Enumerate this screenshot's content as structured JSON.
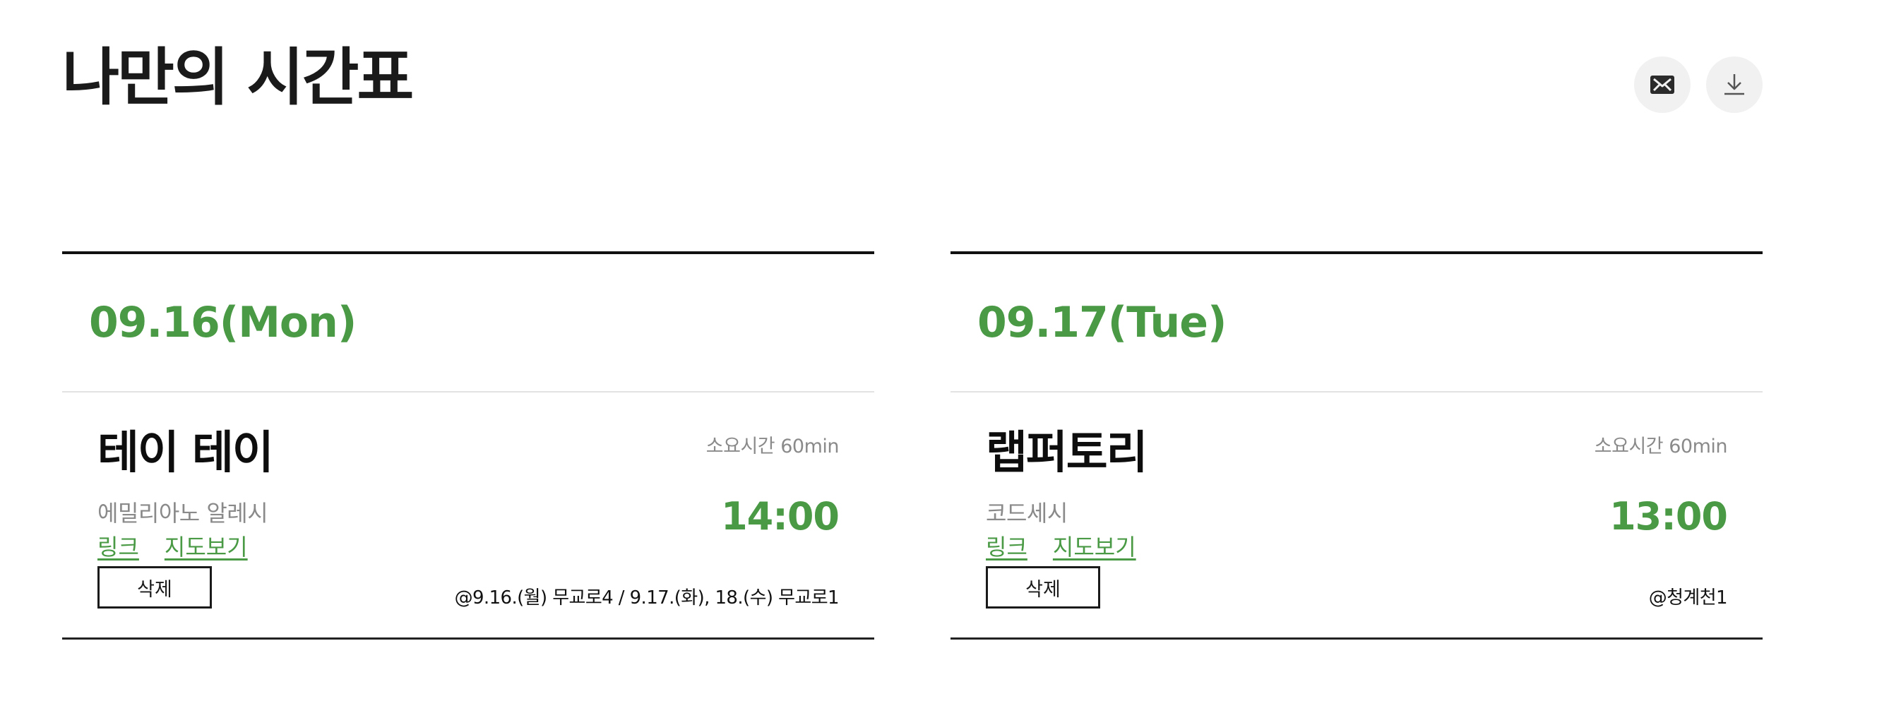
{
  "header": {
    "title": "나만의 시간표",
    "actions": [
      {
        "icon": "mail-icon",
        "label": "Mail"
      },
      {
        "icon": "download-icon",
        "label": "Download"
      }
    ]
  },
  "colors": {
    "accent": "#4a9a45",
    "muted": "#8a8a8a",
    "action_bg": "#f1f1f1"
  },
  "days": [
    {
      "date": "09.16(Mon)",
      "events": [
        {
          "title": "테이 테이",
          "duration": "소요시간 60min",
          "artist": "에밀리아노 알레시",
          "time": "14:00",
          "link_label": "링크",
          "map_label": "지도보기",
          "delete_label": "삭제",
          "location": "@9.16.(월) 무교로4 / 9.17.(화), 18.(수) 무교로1"
        }
      ]
    },
    {
      "date": "09.17(Tue)",
      "events": [
        {
          "title": "랩퍼토리",
          "duration": "소요시간 60min",
          "artist": "코드세시",
          "time": "13:00",
          "link_label": "링크",
          "map_label": "지도보기",
          "delete_label": "삭제",
          "location": "@청계천1"
        }
      ]
    }
  ]
}
